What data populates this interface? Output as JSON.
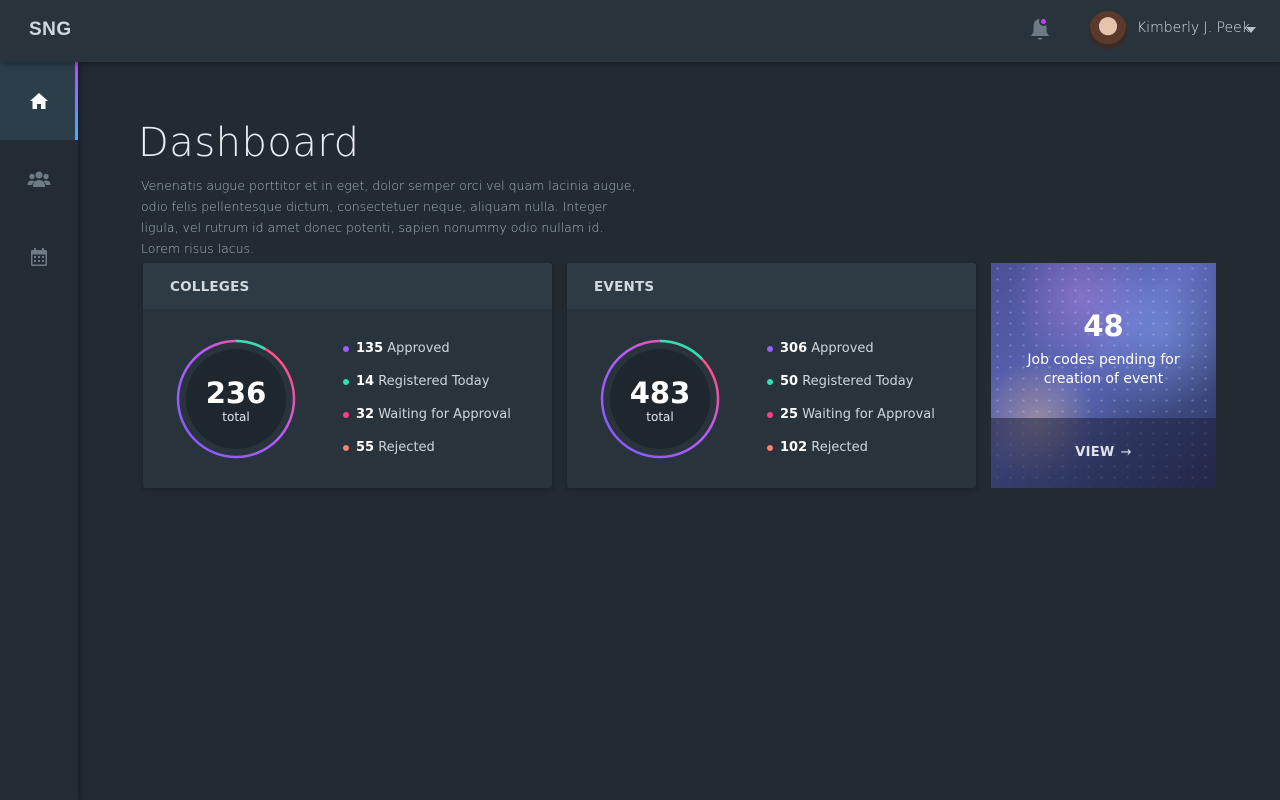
{
  "app": {
    "logo": "SNG"
  },
  "topbar": {
    "user_name": "Kimberly J. Peek",
    "notification_dot_color": "#c23bff"
  },
  "sidebar": {
    "items": [
      {
        "icon": "home-icon",
        "active": true
      },
      {
        "icon": "users-icon",
        "active": false
      },
      {
        "icon": "calendar-icon",
        "active": false
      }
    ],
    "accent_gradient": [
      "#b44bff",
      "#3fb0ff"
    ]
  },
  "header": {
    "title": "Dashboard",
    "description": "Venenatis augue porttitor et in eget, dolor semper orci vel quam lacinia augue, odio felis pellentesque dictum, consectetuer neque, aliquam nulla. Integer ligula, vel rutrum id amet donec potenti, sapien nonummy odio nullam id. Lorem risus lacus."
  },
  "cards": {
    "colleges": {
      "title": "COLLEGES",
      "total": "236",
      "total_label": "total",
      "stats": [
        {
          "value": "135",
          "label": "Approved",
          "color": "#9b5cff"
        },
        {
          "value": "14",
          "label": "Registered Today",
          "color": "#2fe0b0"
        },
        {
          "value": "32",
          "label": "Waiting for Approval",
          "color": "#ff3f8a"
        },
        {
          "value": "55",
          "label": "Rejected",
          "color": "#ff7f72"
        }
      ]
    },
    "events": {
      "title": "EVENTS",
      "total": "483",
      "total_label": "total",
      "stats": [
        {
          "value": "306",
          "label": "Approved",
          "color": "#9b5cff"
        },
        {
          "value": "50",
          "label": "Registered Today",
          "color": "#2fe0b0"
        },
        {
          "value": "25",
          "label": "Waiting for Approval",
          "color": "#ff3f8a"
        },
        {
          "value": "102",
          "label": "Rejected",
          "color": "#ff7f72"
        }
      ]
    }
  },
  "promo": {
    "count": "48",
    "text": "Job codes pending for creation of event",
    "action": "VIEW",
    "action_arrow": "→"
  }
}
